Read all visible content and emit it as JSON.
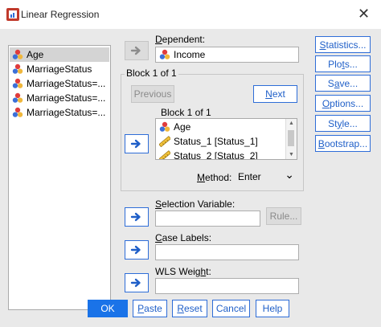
{
  "window": {
    "title": "Linear Regression",
    "close_glyph": "✕"
  },
  "variables": [
    {
      "label": "Age",
      "icon": "scale-variable-icon"
    },
    {
      "label": "MarriageStatus",
      "icon": "scale-variable-icon"
    },
    {
      "label": "MarriageStatus=...",
      "icon": "scale-variable-icon"
    },
    {
      "label": "MarriageStatus=...",
      "icon": "scale-variable-icon"
    },
    {
      "label": "MarriageStatus=...",
      "icon": "scale-variable-icon"
    }
  ],
  "dependent": {
    "label": "Dependent:",
    "value": "Income"
  },
  "block_group": {
    "legend": "Block 1 of 1",
    "previous": "Previous",
    "next": "Next",
    "inner_label": "Block 1 of 1"
  },
  "independents": [
    {
      "label": "Age",
      "icon": "scale-variable-icon"
    },
    {
      "label": "Status_1 [Status_1]",
      "icon": "ruler-variable-icon"
    },
    {
      "label": "Status_2 [Status_2]",
      "icon": "ruler-variable-icon"
    }
  ],
  "method": {
    "label": "Method:",
    "value": "Enter",
    "chevron": "⌄"
  },
  "selection_variable": {
    "label": "Selection Variable:",
    "rule": "Rule..."
  },
  "case_labels": {
    "label": "Case Labels:"
  },
  "wls_weight": {
    "label": "WLS Weight:"
  },
  "side_buttons": [
    "Statistics...",
    "Plots...",
    "Save...",
    "Options...",
    "Style...",
    "Bootstrap..."
  ],
  "bottom_buttons": {
    "ok": "OK",
    "paste": "Paste",
    "reset": "Reset",
    "cancel": "Cancel",
    "help": "Help"
  },
  "colors": {
    "accent": "#1a73e8",
    "border_blue": "#2e6dd8",
    "selection": "#d4d4d4"
  }
}
